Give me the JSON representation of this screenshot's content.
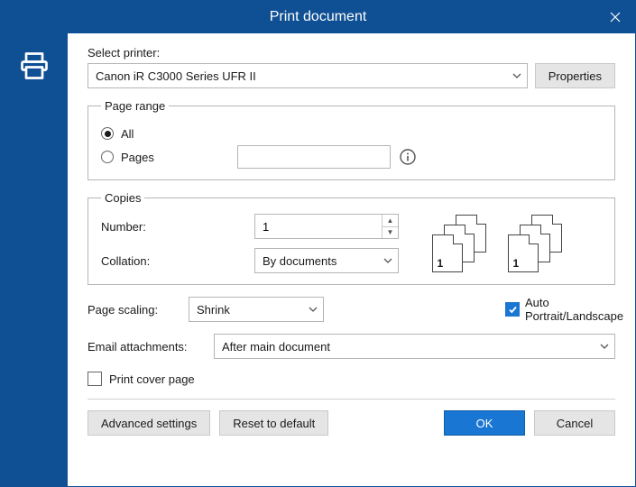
{
  "title": "Print document",
  "printer": {
    "label": "Select printer:",
    "selected": "Canon iR C3000 Series UFR II",
    "properties_label": "Properties"
  },
  "page_range": {
    "legend": "Page range",
    "all_label": "All",
    "pages_label": "Pages",
    "pages_value": "",
    "selected": "all"
  },
  "copies": {
    "legend": "Copies",
    "number_label": "Number:",
    "number_value": "1",
    "collation_label": "Collation:",
    "collation_selected": "By documents"
  },
  "scaling": {
    "label": "Page scaling:",
    "selected": "Shrink",
    "auto_orient_label": "Auto Portrait/Landscape",
    "auto_orient_checked": true
  },
  "attachments": {
    "label": "Email attachments:",
    "selected": "After main document"
  },
  "cover": {
    "label": "Print cover page",
    "checked": false
  },
  "footer": {
    "advanced_label": "Advanced settings",
    "reset_label": "Reset to default",
    "ok_label": "OK",
    "cancel_label": "Cancel"
  }
}
